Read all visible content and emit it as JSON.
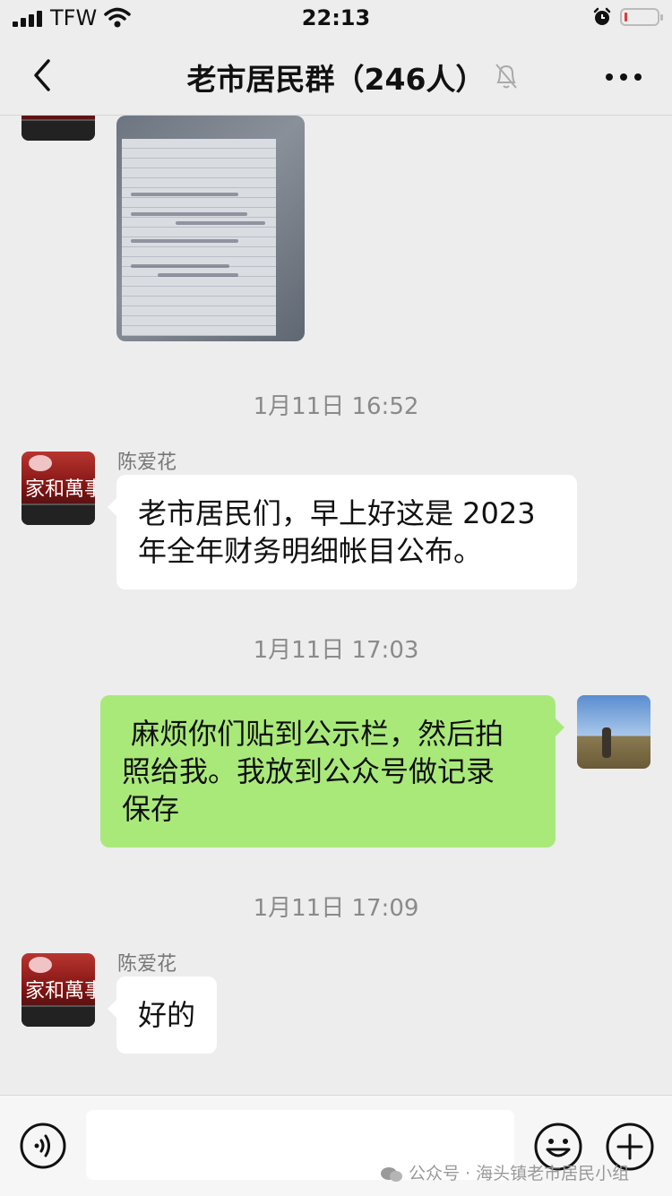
{
  "status_bar": {
    "carrier": "TFW",
    "time": "22:13"
  },
  "nav": {
    "title": "老市居民群（246人）",
    "icons": [
      "back-icon",
      "mute-bell-icon",
      "more-icon"
    ]
  },
  "messages": [
    {
      "type": "image",
      "direction": "incoming",
      "description_icon": "document-photo"
    },
    {
      "type": "timestamp",
      "text": "1月11日 16:52"
    },
    {
      "type": "text",
      "direction": "incoming",
      "sender": "陈爱花",
      "avatar_text": "家和萬事興",
      "lines": [
        "老市居民们，早上好这是 2023",
        "年全年财务明细帐目公布。"
      ]
    },
    {
      "type": "timestamp",
      "text": "1月11日 17:03"
    },
    {
      "type": "text",
      "direction": "outgoing",
      "lines": [
        " 麻烦你们贴到公示栏，然后拍",
        "照给我。我放到公众号做记录",
        "保存"
      ]
    },
    {
      "type": "timestamp",
      "text": "1月11日 17:09"
    },
    {
      "type": "text",
      "direction": "incoming",
      "sender": "陈爱花",
      "avatar_text": "家和萬事興",
      "lines": [
        "好的"
      ]
    }
  ],
  "input_bar": {
    "icons": [
      "voice-icon",
      "emoji-icon",
      "plus-icon"
    ],
    "watermark": "公众号 · 海头镇老市居民小组"
  },
  "colors": {
    "background": "#ededed",
    "incoming_bubble": "#ffffff",
    "outgoing_bubble": "#a9e97a",
    "timestamp_text": "#8a8a8a"
  }
}
